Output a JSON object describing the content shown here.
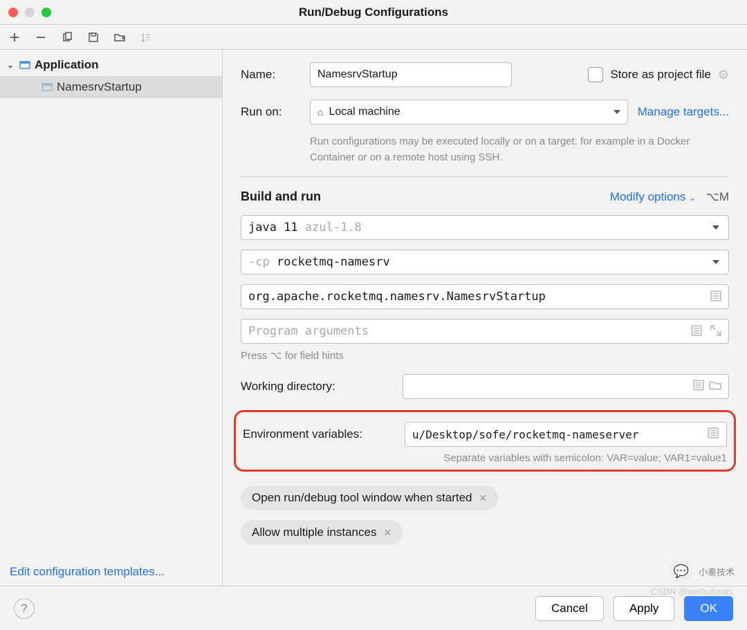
{
  "window": {
    "title": "Run/Debug Configurations"
  },
  "tree": {
    "root": {
      "label": "Application"
    },
    "children": [
      {
        "label": "NamesrvStartup"
      }
    ]
  },
  "sidebar": {
    "editTemplates": "Edit configuration templates..."
  },
  "form": {
    "nameLabel": "Name:",
    "nameValue": "NamesrvStartup",
    "storeProjectFile": "Store as project file",
    "runOnLabel": "Run on:",
    "runOnValue": "Local machine",
    "manageTargets": "Manage targets...",
    "runOnHint": "Run configurations may be executed locally or on a target: for example in a Docker Container or on a remote host using SSH.",
    "buildAndRun": "Build and run",
    "modifyOptions": "Modify options",
    "modifyShortcut": "⌥M",
    "jdk": {
      "primary": "java 11",
      "secondary": "azul-1.8"
    },
    "cp": {
      "prefix": "-cp",
      "value": "rocketmq-namesrv"
    },
    "mainClass": "org.apache.rocketmq.namesrv.NamesrvStartup",
    "programArgsPlaceholder": "Program arguments",
    "fieldHints": "Press ⌥ for field hints",
    "workingDirLabel": "Working directory:",
    "workingDirValue": "",
    "envLabel": "Environment variables:",
    "envValue": "u/Desktop/sofe/rocketmq-nameserver",
    "envHint": "Separate variables with semicolon: VAR=value; VAR1=value1",
    "chips": [
      "Open run/debug tool window when started",
      "Allow multiple instances"
    ]
  },
  "footer": {
    "cancel": "Cancel",
    "apply": "Apply",
    "ok": "OK"
  },
  "watermark": {
    "brand": "小奏技术",
    "csdn": "CSDN @weihubeats"
  }
}
